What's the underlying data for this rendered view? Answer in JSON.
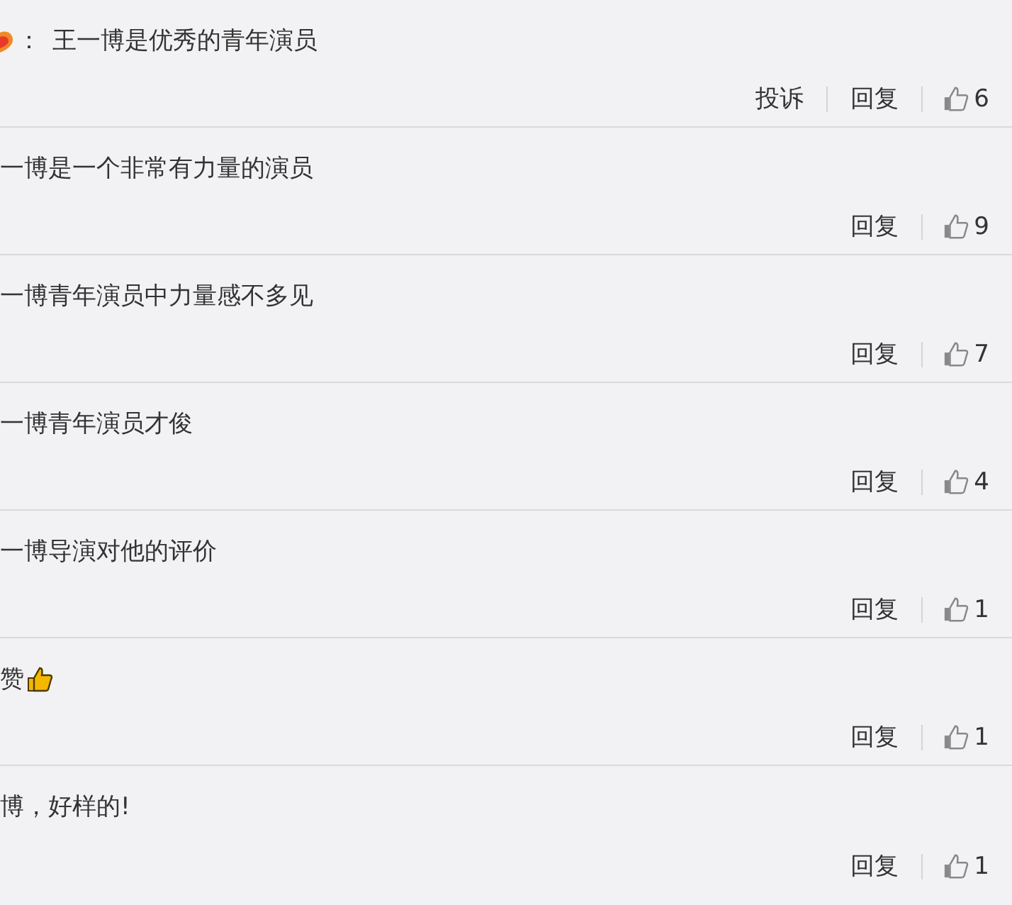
{
  "comments": [
    {
      "lead_emoji": true,
      "prefix": "：",
      "text": "王一博是优秀的青年演员",
      "trail_emoji": false,
      "actions": [
        "投诉",
        "回复"
      ],
      "likes": "6"
    },
    {
      "lead_emoji": false,
      "text": "一博是一个非常有力量的演员",
      "trail_emoji": false,
      "actions": [
        "回复"
      ],
      "likes": "9"
    },
    {
      "lead_emoji": false,
      "text": "一博青年演员中力量感不多见",
      "trail_emoji": false,
      "actions": [
        "回复"
      ],
      "likes": "7"
    },
    {
      "lead_emoji": false,
      "text": "一博青年演员才俊",
      "trail_emoji": false,
      "actions": [
        "回复"
      ],
      "likes": "4"
    },
    {
      "lead_emoji": false,
      "text": "一博导演对他的评价",
      "trail_emoji": false,
      "actions": [
        "回复"
      ],
      "likes": "1"
    },
    {
      "lead_emoji": false,
      "text": "赞",
      "trail_emoji": true,
      "actions": [
        "回复"
      ],
      "likes": "1"
    },
    {
      "lead_emoji": false,
      "text": "博，好样的!",
      "trail_emoji": false,
      "actions": [
        "回复"
      ],
      "likes": "1"
    }
  ]
}
